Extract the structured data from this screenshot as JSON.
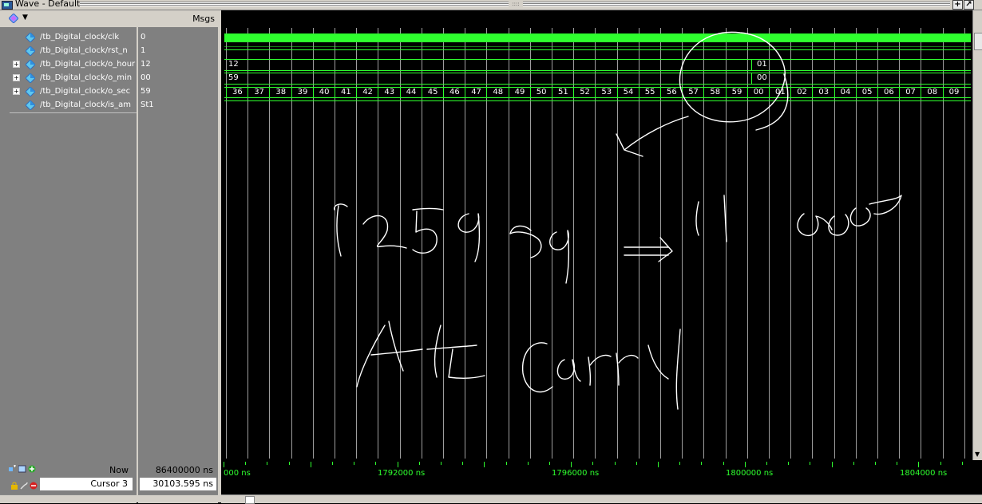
{
  "window": {
    "title": "Wave - Default"
  },
  "header": {
    "msgs_label": "Msgs"
  },
  "signals": [
    {
      "name": "/tb_Digital_clock/clk",
      "value": "0",
      "expandable": false
    },
    {
      "name": "/tb_Digital_clock/rst_n",
      "value": "1",
      "expandable": false
    },
    {
      "name": "/tb_Digital_clock/o_hour",
      "value": "12",
      "expandable": true
    },
    {
      "name": "/tb_Digital_clock/o_min",
      "value": "00",
      "expandable": true
    },
    {
      "name": "/tb_Digital_clock/o_sec",
      "value": "59",
      "expandable": true
    },
    {
      "name": "/tb_Digital_clock/is_am",
      "value": "St1",
      "expandable": false
    }
  ],
  "wave": {
    "hour_before": "12",
    "hour_after": "01",
    "min_before": "59",
    "min_after": "00",
    "sec_values": [
      "36",
      "37",
      "38",
      "39",
      "40",
      "41",
      "42",
      "43",
      "44",
      "45",
      "46",
      "47",
      "48",
      "49",
      "50",
      "51",
      "52",
      "53",
      "54",
      "55",
      "56",
      "57",
      "58",
      "59",
      "00",
      "01",
      "02",
      "03",
      "04",
      "05",
      "06",
      "07",
      "08",
      "09"
    ]
  },
  "timeline": {
    "tick_labels": [
      "000 ns",
      "1792000 ns",
      "1796000 ns",
      "1800000 ns",
      "1804000 ns"
    ]
  },
  "status": {
    "now_label": "Now",
    "now_value": "86400000 ns",
    "cursor_label": "Cursor 3",
    "cursor_value": "30103.595 ns"
  },
  "colors": {
    "wave_green": "#2eff2e",
    "background": "#000000",
    "pane_gray": "#808080"
  }
}
